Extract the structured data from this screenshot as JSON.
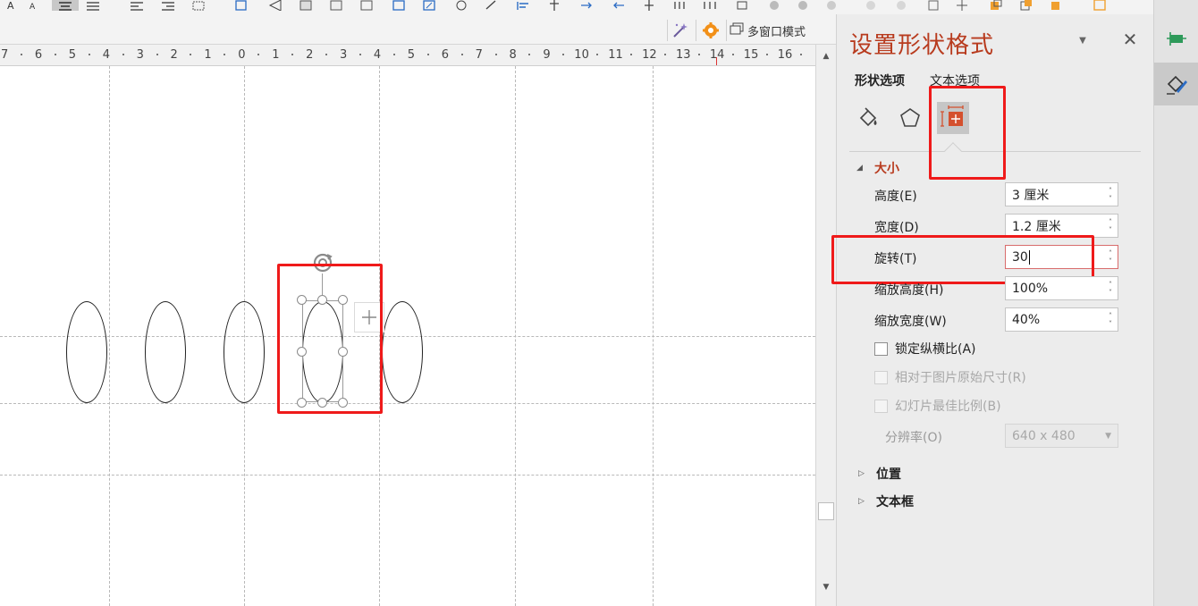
{
  "toolbar": {
    "multi_window_label": "多窗口模式"
  },
  "ruler": {
    "numbers": [
      "7",
      "6",
      "5",
      "4",
      "3",
      "2",
      "1",
      "0",
      "1",
      "2",
      "3",
      "4",
      "5",
      "6",
      "7",
      "8",
      "9",
      "10",
      "11",
      "12",
      "13",
      "14",
      "15",
      "16"
    ]
  },
  "pane": {
    "title": "设置形状格式",
    "tabs": [
      "形状选项",
      "文本选项"
    ],
    "icon_tabs": [
      "fill-line-icon",
      "effects-pentagon-icon",
      "size-properties-icon"
    ],
    "size_section": {
      "label": "大小",
      "fields": [
        {
          "label": "高度(E)",
          "value": "3 厘米"
        },
        {
          "label": "宽度(D)",
          "value": "1.2 厘米"
        },
        {
          "label": "旋转(T)",
          "value": "30"
        },
        {
          "label": "缩放高度(H)",
          "value": "100%"
        },
        {
          "label": "缩放宽度(W)",
          "value": "40%"
        }
      ],
      "checkboxes": [
        {
          "label": "锁定纵横比(A)",
          "checked": false,
          "enabled": true
        },
        {
          "label": "相对于图片原始尺寸(R)",
          "checked": false,
          "enabled": false
        },
        {
          "label": "幻灯片最佳比例(B)",
          "checked": false,
          "enabled": false
        }
      ],
      "resolution_label": "分辨率(O)",
      "resolution_value": "640 x 480"
    },
    "collapsed_sections": [
      "位置",
      "文本框"
    ]
  },
  "colors": {
    "accent": "#b83b1e",
    "highlight": "#ef1a1a"
  }
}
